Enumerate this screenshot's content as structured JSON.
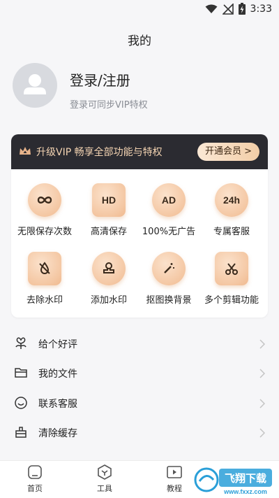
{
  "status_bar": {
    "time": "3:33"
  },
  "header": {
    "title": "我的"
  },
  "profile": {
    "login_label": "登录/注册",
    "subtitle": "登录可同步VIP特权"
  },
  "vip": {
    "banner_text": "升级VIP 畅享全部功能与特权",
    "open_button": "开通会员 >",
    "accent_color": "#f4c7a3",
    "banner_color": "#2b2b31",
    "features": [
      {
        "label": "无限保存次数",
        "icon": "infinity-icon"
      },
      {
        "label": "高清保存",
        "icon": "hd-icon",
        "icon_text": "HD"
      },
      {
        "label": "100%无广告",
        "icon": "ad-icon",
        "icon_text": "AD"
      },
      {
        "label": "专属客服",
        "icon": "24h-icon",
        "icon_text": "24h"
      },
      {
        "label": "去除水印",
        "icon": "remove-watermark-icon"
      },
      {
        "label": "添加水印",
        "icon": "stamp-icon"
      },
      {
        "label": "抠图换背景",
        "icon": "magic-wand-icon"
      },
      {
        "label": "多个剪辑功能",
        "icon": "scissors-icon"
      }
    ]
  },
  "menu": [
    {
      "label": "给个好评",
      "icon": "flower-icon"
    },
    {
      "label": "我的文件",
      "icon": "folder-icon"
    },
    {
      "label": "联系客服",
      "icon": "headset-icon"
    },
    {
      "label": "清除缓存",
      "icon": "broom-icon"
    }
  ],
  "bottom_nav": [
    {
      "label": "首页",
      "icon": "home-icon"
    },
    {
      "label": "工具",
      "icon": "cube-icon"
    },
    {
      "label": "教程",
      "icon": "play-icon"
    }
  ],
  "watermark": {
    "brand": "飞翔下载",
    "url": "www.fxxz.com"
  }
}
